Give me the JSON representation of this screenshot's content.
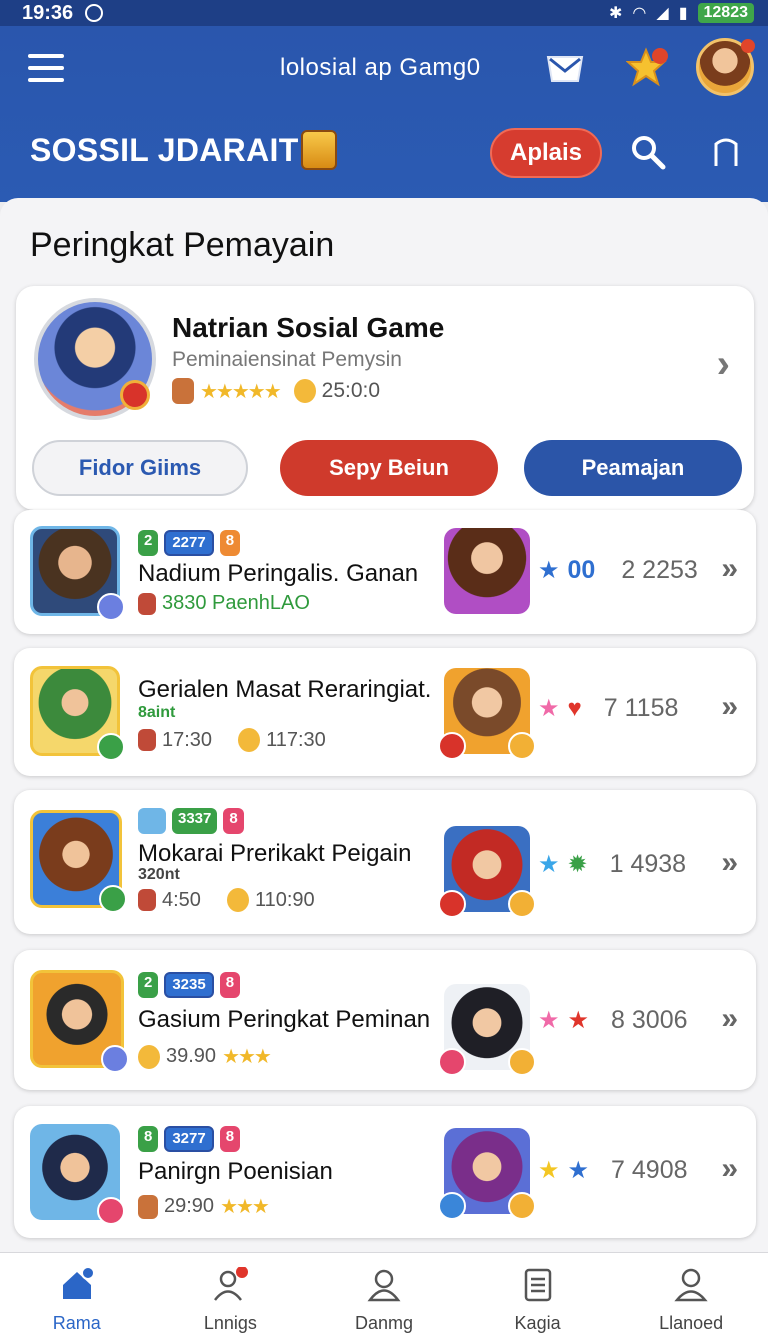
{
  "status_bar": {
    "time": "19:36",
    "battery": "12823"
  },
  "header": {
    "app_title": "lolosial ap Gamg0",
    "brand": "SOSSIL JDARAIT",
    "cta_label": "Aplais"
  },
  "section": {
    "title": "Peringkat Pemayain"
  },
  "featured": {
    "title": "Natrian Sosial Game",
    "subtitle": "Peminaiensinat Pemysin",
    "stars": "★★★★★",
    "score": "25:0:0",
    "buttons": {
      "friend": "Fidor Giims",
      "play": "Sepy Beiun",
      "join": "Peamajan"
    }
  },
  "rows": [
    {
      "tags": [
        "2",
        "2277",
        "8"
      ],
      "name": "Nadium Peringalis. Ganan",
      "sub": "3830 PaenhLAO",
      "sub_extra": "",
      "value": "00",
      "rank": "2 2253"
    },
    {
      "tags": [],
      "name": "Gerialen Masat Reraringiat.",
      "sub2": "8aint",
      "time1": "17:30",
      "time2": "117:30",
      "rank": "7 1158"
    },
    {
      "tags": [
        "3337",
        "8"
      ],
      "name": "Mokarai Prerikakt Peigain",
      "sub2": "320nt",
      "time1": "4:50",
      "time2": "110:90",
      "rank": "1 4938"
    },
    {
      "tags": [
        "2",
        "3235",
        "8"
      ],
      "name": "Gasium Peringkat Peminan",
      "time1": "39.90",
      "stars": "★★★",
      "rank": "8 3006"
    },
    {
      "tags": [
        "8",
        "3277",
        "8"
      ],
      "name": "Panirgn Poenisian",
      "time1": "29:90",
      "stars": "★★★",
      "rank": "7 4908"
    }
  ],
  "nav": [
    {
      "label": "Rama",
      "icon": "home-icon"
    },
    {
      "label": "Lnnigs",
      "icon": "friends-icon"
    },
    {
      "label": "Danmg",
      "icon": "profile-icon"
    },
    {
      "label": "Kagia",
      "icon": "list-icon"
    },
    {
      "label": "Llanoed",
      "icon": "account-icon"
    }
  ],
  "colors": {
    "header": "#2a56ad",
    "accent_red": "#cf3a2c",
    "accent_blue": "#2b55a8",
    "active_nav": "#2b66c7"
  }
}
